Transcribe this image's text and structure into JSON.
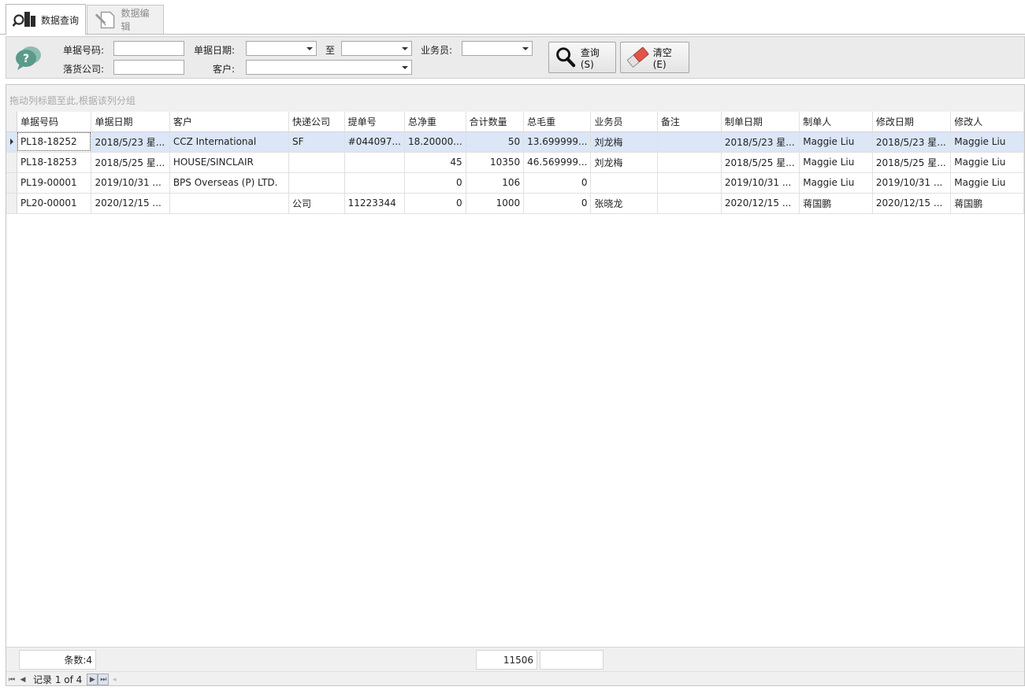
{
  "tabs": [
    {
      "label": "数据查询",
      "icon": "search-doc-icon",
      "active": true
    },
    {
      "label": "数据编辑",
      "icon": "edit-doc-icon",
      "active": false
    }
  ],
  "search": {
    "doc_no_label": "单据号码:",
    "doc_no_value": "",
    "date_label": "单据日期:",
    "date_from": "",
    "to_label": "至",
    "date_to": "",
    "sales_label": "业务员:",
    "sales_value": "",
    "company_label": "落货公司:",
    "company_value": "",
    "customer_label": "客户:",
    "customer_value": "",
    "query_button": "查询(S)",
    "clear_button": "清空(E)"
  },
  "grid": {
    "group_hint": "拖动列标题至此,根据该列分组",
    "columns": [
      "单据号码",
      "单据日期",
      "客户",
      "快递公司",
      "提单号",
      "总净重",
      "合计数量",
      "总毛重",
      "业务员",
      "备注",
      "制单日期",
      "制单人",
      "修改日期",
      "修改人"
    ],
    "rows": [
      [
        "PL18-18252",
        "2018/5/23 星...",
        "CCZ International",
        "SF",
        "#044097...",
        "18.20000...",
        "50",
        "13.699999...",
        "刘龙梅",
        "",
        "2018/5/23 星...",
        "Maggie Liu",
        "2018/5/23 星...",
        "Maggie Liu"
      ],
      [
        "PL18-18253",
        "2018/5/25 星...",
        "HOUSE/SINCLAIR",
        "",
        "",
        "45",
        "10350",
        "46.569999...",
        "刘龙梅",
        "",
        "2018/5/25 星...",
        "Maggie Liu",
        "2018/5/25 星...",
        "Maggie Liu"
      ],
      [
        "PL19-00001",
        "2019/10/31 ...",
        "BPS Overseas (P) LTD.",
        "",
        "",
        "0",
        "106",
        "0",
        "",
        "",
        "2019/10/31 ...",
        "Maggie Liu",
        "2019/10/31 ...",
        "Maggie Liu"
      ],
      [
        "PL20-00001",
        "2020/12/15 ...",
        "",
        "公司",
        "11223344",
        "0",
        "1000",
        "0",
        "张晓龙",
        "",
        "2020/12/15 ...",
        "蒋国鹏",
        "2020/12/15 ...",
        "蒋国鹏"
      ]
    ],
    "selected_row": 0
  },
  "footer": {
    "count": "条数:4",
    "qty_total": "11506",
    "gross_total": ""
  },
  "navigator": {
    "record_text": "记录 1 of 4"
  },
  "colors": {
    "selected_row": "#dbe6f7",
    "panel_bg": "#ebebeb",
    "help_icon": "#5b9a8b",
    "eraser": "#e0554a"
  }
}
